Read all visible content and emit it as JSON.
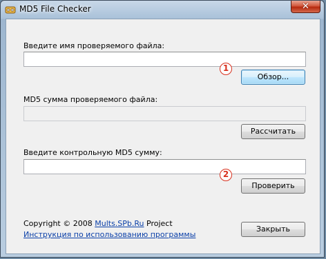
{
  "window": {
    "title": "MD5 File Checker",
    "close_symbol": "✕"
  },
  "file_section": {
    "label": "Введите имя проверяемого файла:",
    "value": "",
    "browse_label": "Обзор...",
    "marker": "1"
  },
  "md5_section": {
    "label": "MD5 сумма проверяемого файла:",
    "value": "",
    "calculate_label": "Рассчитать"
  },
  "control_section": {
    "label": "Введите контрольную MD5 сумму:",
    "value": "",
    "check_label": "Проверить",
    "marker": "2"
  },
  "footer": {
    "copyright_prefix": "Copyright © 2008 ",
    "site_link": "Mults.SPb.Ru",
    "copyright_suffix": " Project",
    "instructions_link": "Инструкция по использованию программы",
    "close_label": "Закрыть"
  },
  "colors": {
    "marker": "#d8301d",
    "link": "#0a3fa8",
    "focus_button": "#3c7fb1"
  }
}
